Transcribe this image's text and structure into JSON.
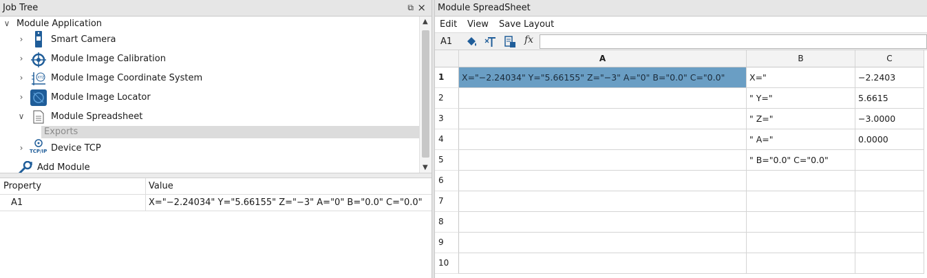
{
  "job_tree": {
    "title": "Job Tree",
    "float_icon": "⧉",
    "close_icon": "×",
    "items": [
      {
        "label": "Module Application",
        "arrow": "∨",
        "icon": "none"
      },
      {
        "label": "Smart Camera",
        "arrow": "›",
        "icon": "smart-camera-icon"
      },
      {
        "label": "Module Image Calibration",
        "arrow": "›",
        "icon": "calibration-icon"
      },
      {
        "label": "Module Image Coordinate System",
        "arrow": "›",
        "icon": "coordinate-system-icon"
      },
      {
        "label": "Module Image Locator",
        "arrow": "›",
        "icon": "locator-icon"
      },
      {
        "label": "Module Spreadsheet",
        "arrow": "∨",
        "icon": "spreadsheet-icon"
      },
      {
        "label": "Exports",
        "arrow": "",
        "icon": "none"
      },
      {
        "label": "Device TCP",
        "arrow": "›",
        "icon": "tcp-ip-icon"
      },
      {
        "label": "Add Module",
        "arrow": "",
        "icon": "wrench-icon"
      }
    ],
    "tcp_icon_text": "TCP/IP",
    "coord_icon_text": "XYZ"
  },
  "properties": {
    "col_property": "Property",
    "col_value": "Value",
    "rows": [
      {
        "property": "A1",
        "value": "X=\"−2.24034\" Y=\"5.66155\" Z=\"−3\" A=\"0\" B=\"0.0\" C=\"0.0\""
      }
    ]
  },
  "spreadsheet": {
    "title": "Module SpreadSheet",
    "menu": [
      "Edit",
      "View",
      "Save Layout"
    ],
    "cell_ref": "A1",
    "fx_label": "fx",
    "formula_value": "",
    "toolbar_icons": [
      "paint-bucket-icon",
      "text-format-icon",
      "export-icon"
    ],
    "columns": [
      "A",
      "B",
      "C"
    ],
    "rows": [
      {
        "n": "1",
        "a": "X=\"−2.24034\" Y=\"5.66155\" Z=\"−3\" A=\"0\" B=\"0.0\" C=\"0.0\"",
        "b": "X=\"",
        "c": "−2.2403"
      },
      {
        "n": "2",
        "a": "",
        "b": "\" Y=\"",
        "c": "5.6615"
      },
      {
        "n": "3",
        "a": "",
        "b": "\" Z=\"",
        "c": "−3.0000"
      },
      {
        "n": "4",
        "a": "",
        "b": "\" A=\"",
        "c": "0.0000"
      },
      {
        "n": "5",
        "a": "",
        "b": "\" B=\"0.0\" C=\"0.0\"",
        "c": ""
      },
      {
        "n": "6",
        "a": "",
        "b": "",
        "c": ""
      },
      {
        "n": "7",
        "a": "",
        "b": "",
        "c": ""
      },
      {
        "n": "8",
        "a": "",
        "b": "",
        "c": ""
      },
      {
        "n": "9",
        "a": "",
        "b": "",
        "c": ""
      },
      {
        "n": "10",
        "a": "",
        "b": "",
        "c": ""
      }
    ],
    "selection_color": "#6a9ec4"
  }
}
